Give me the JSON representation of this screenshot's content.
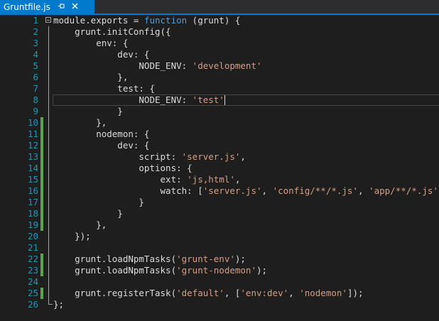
{
  "tab": {
    "filename": "Gruntfile.js",
    "pin_icon": "pin-icon",
    "close_icon": "close-icon",
    "active_color": "#007acc"
  },
  "editor": {
    "current_line": 8,
    "saved_change_lines": [
      10,
      11,
      12,
      13,
      14,
      15,
      16,
      17,
      18,
      19,
      22,
      23,
      25
    ],
    "lines": [
      {
        "n": "1",
        "tokens": [
          {
            "t": "module.exports = ",
            "c": "plain"
          },
          {
            "t": "function",
            "c": "kw"
          },
          {
            "t": " (grunt) {",
            "c": "plain"
          }
        ]
      },
      {
        "n": "2",
        "tokens": [
          {
            "t": "    grunt.initConfig({",
            "c": "plain"
          }
        ]
      },
      {
        "n": "3",
        "tokens": [
          {
            "t": "        env: {",
            "c": "plain"
          }
        ]
      },
      {
        "n": "4",
        "tokens": [
          {
            "t": "            dev: {",
            "c": "plain"
          }
        ]
      },
      {
        "n": "5",
        "tokens": [
          {
            "t": "                NODE_ENV: ",
            "c": "plain"
          },
          {
            "t": "'development'",
            "c": "str"
          }
        ]
      },
      {
        "n": "6",
        "tokens": [
          {
            "t": "            },",
            "c": "plain"
          }
        ]
      },
      {
        "n": "7",
        "tokens": [
          {
            "t": "            test: {",
            "c": "plain"
          }
        ]
      },
      {
        "n": "8",
        "tokens": [
          {
            "t": "                NODE_ENV: ",
            "c": "plain"
          },
          {
            "t": "'test'",
            "c": "str"
          }
        ]
      },
      {
        "n": "9",
        "tokens": [
          {
            "t": "            }",
            "c": "plain"
          }
        ]
      },
      {
        "n": "10",
        "tokens": [
          {
            "t": "        },",
            "c": "plain"
          }
        ]
      },
      {
        "n": "11",
        "tokens": [
          {
            "t": "        nodemon: {",
            "c": "plain"
          }
        ]
      },
      {
        "n": "12",
        "tokens": [
          {
            "t": "            dev: {",
            "c": "plain"
          }
        ]
      },
      {
        "n": "13",
        "tokens": [
          {
            "t": "                script: ",
            "c": "plain"
          },
          {
            "t": "'server.js'",
            "c": "str"
          },
          {
            "t": ",",
            "c": "plain"
          }
        ]
      },
      {
        "n": "14",
        "tokens": [
          {
            "t": "                options: {",
            "c": "plain"
          }
        ]
      },
      {
        "n": "15",
        "tokens": [
          {
            "t": "                    ext: ",
            "c": "plain"
          },
          {
            "t": "'js,html'",
            "c": "str"
          },
          {
            "t": ",",
            "c": "plain"
          }
        ]
      },
      {
        "n": "16",
        "tokens": [
          {
            "t": "                    watch: [",
            "c": "plain"
          },
          {
            "t": "'server.js'",
            "c": "str"
          },
          {
            "t": ", ",
            "c": "plain"
          },
          {
            "t": "'config/**/*.js'",
            "c": "str"
          },
          {
            "t": ", ",
            "c": "plain"
          },
          {
            "t": "'app/**/*.js'",
            "c": "str"
          },
          {
            "t": "]",
            "c": "plain"
          }
        ]
      },
      {
        "n": "17",
        "tokens": [
          {
            "t": "                }",
            "c": "plain"
          }
        ]
      },
      {
        "n": "18",
        "tokens": [
          {
            "t": "            }",
            "c": "plain"
          }
        ]
      },
      {
        "n": "19",
        "tokens": [
          {
            "t": "        },",
            "c": "plain"
          }
        ]
      },
      {
        "n": "20",
        "tokens": [
          {
            "t": "    });",
            "c": "plain"
          }
        ]
      },
      {
        "n": "21",
        "tokens": []
      },
      {
        "n": "22",
        "tokens": [
          {
            "t": "    grunt.loadNpmTasks(",
            "c": "plain"
          },
          {
            "t": "'grunt-env'",
            "c": "str"
          },
          {
            "t": ");",
            "c": "plain"
          }
        ]
      },
      {
        "n": "23",
        "tokens": [
          {
            "t": "    grunt.loadNpmTasks(",
            "c": "plain"
          },
          {
            "t": "'grunt-nodemon'",
            "c": "str"
          },
          {
            "t": ");",
            "c": "plain"
          }
        ]
      },
      {
        "n": "24",
        "tokens": []
      },
      {
        "n": "25",
        "tokens": [
          {
            "t": "    grunt.registerTask(",
            "c": "plain"
          },
          {
            "t": "'default'",
            "c": "str"
          },
          {
            "t": ", [",
            "c": "plain"
          },
          {
            "t": "'env:dev'",
            "c": "str"
          },
          {
            "t": ", ",
            "c": "plain"
          },
          {
            "t": "'nodemon'",
            "c": "str"
          },
          {
            "t": "]);",
            "c": "plain"
          }
        ]
      },
      {
        "n": "26",
        "tokens": [
          {
            "t": "};",
            "c": "plain"
          }
        ]
      }
    ]
  }
}
